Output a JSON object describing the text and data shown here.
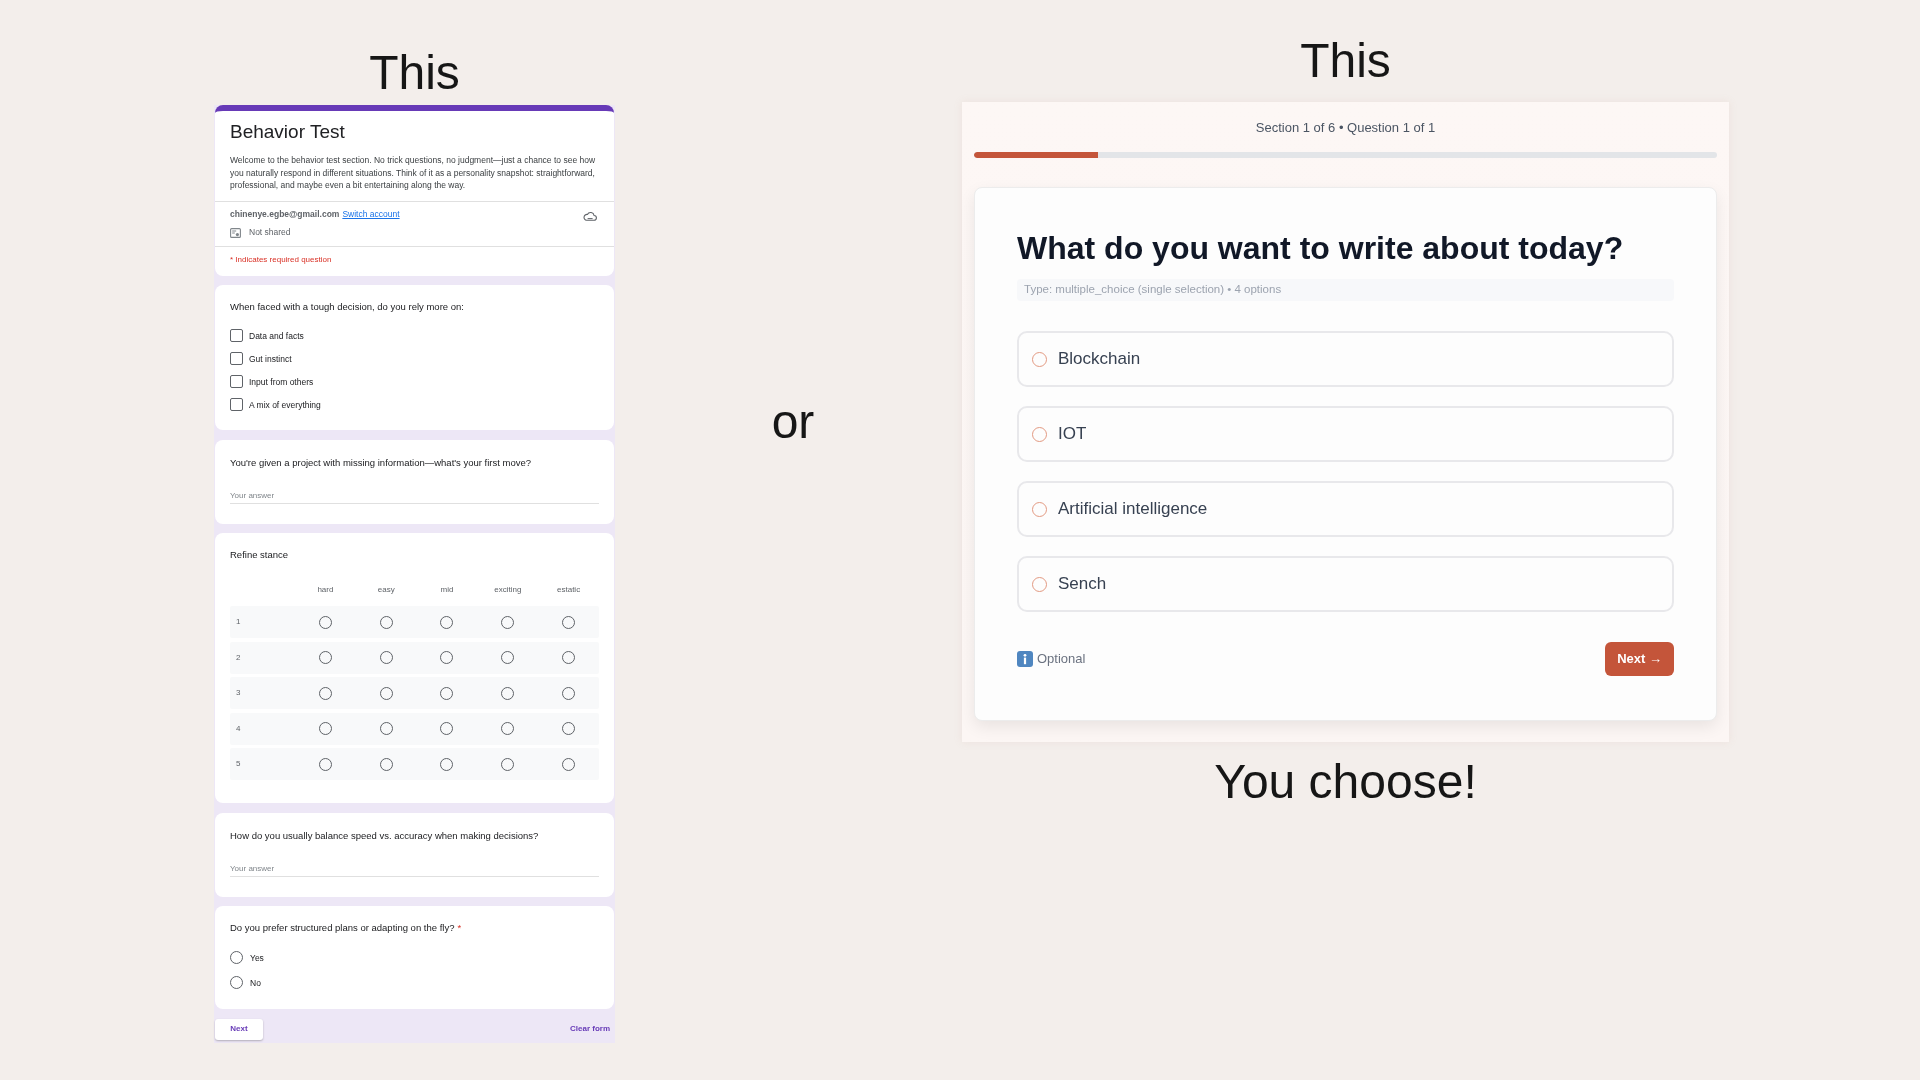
{
  "captions": {
    "left": "This",
    "middle": "or",
    "right": "This",
    "closing": "You choose!"
  },
  "google_form": {
    "title": "Behavior Test",
    "description": "Welcome to the behavior test section. No trick questions, no judgment—just a chance to see how you naturally respond in different situations. Think of it as a personality snapshot: straightforward, professional, and maybe even a bit entertaining along the way.",
    "account": {
      "email": "chinenye.egbe@gmail.com",
      "switch_link": "Switch account",
      "sharing": "Not shared"
    },
    "required_note": "* Indicates required question",
    "questions": [
      {
        "kind": "checkboxes",
        "prompt": "When faced with a tough decision, do you rely more on:",
        "options": [
          {
            "label": "Data and facts",
            "checked": false
          },
          {
            "label": "Gut instinct",
            "checked": false
          },
          {
            "label": "Input from others",
            "checked": false
          },
          {
            "label": "A mix of everything",
            "checked": false
          }
        ]
      },
      {
        "kind": "short_answer",
        "prompt": "You're given a project with missing information—what's your first move?",
        "placeholder": "Your answer"
      },
      {
        "kind": "grid",
        "prompt": "Refine stance",
        "columns": [
          "hard",
          "easy",
          "mid",
          "exciting",
          "estatic"
        ],
        "rows": [
          {
            "label": "1",
            "cells": [
              {
                "selected": false
              },
              {
                "selected": false
              },
              {
                "selected": false
              },
              {
                "selected": false
              },
              {
                "selected": false
              }
            ]
          },
          {
            "label": "2",
            "cells": [
              {
                "selected": false
              },
              {
                "selected": false
              },
              {
                "selected": false
              },
              {
                "selected": false
              },
              {
                "selected": false
              }
            ]
          },
          {
            "label": "3",
            "cells": [
              {
                "selected": false
              },
              {
                "selected": false
              },
              {
                "selected": false
              },
              {
                "selected": false
              },
              {
                "selected": false
              }
            ]
          },
          {
            "label": "4",
            "cells": [
              {
                "selected": false
              },
              {
                "selected": false
              },
              {
                "selected": false
              },
              {
                "selected": false
              },
              {
                "selected": false
              }
            ]
          },
          {
            "label": "5",
            "cells": [
              {
                "selected": false
              },
              {
                "selected": false
              },
              {
                "selected": false
              },
              {
                "selected": false
              },
              {
                "selected": false
              }
            ]
          }
        ]
      },
      {
        "kind": "short_answer",
        "prompt": "How do you usually balance speed vs. accuracy when making decisions?",
        "placeholder": "Your answer"
      },
      {
        "kind": "radio",
        "prompt": "Do you prefer structured plans or adapting on the fly?",
        "required_mark": "*",
        "options": [
          {
            "label": "Yes",
            "selected": false
          },
          {
            "label": "No",
            "selected": false
          }
        ]
      }
    ],
    "next_button": "Next",
    "clear_button": "Clear form"
  },
  "quiz_panel": {
    "progress_text": "Section 1 of 6 • Question 1 of 1",
    "progress": {
      "level": 0.167
    },
    "question": "What do you want to write about today?",
    "meta": "Type: multiple_choice (single selection) • 4 options",
    "options": [
      {
        "label": "Blockchain",
        "selected": false
      },
      {
        "label": "IOT",
        "selected": false
      },
      {
        "label": "Artificial intelligence",
        "selected": false
      },
      {
        "label": "Sench",
        "selected": false
      }
    ],
    "note": "Optional",
    "next_button": "Next →"
  }
}
